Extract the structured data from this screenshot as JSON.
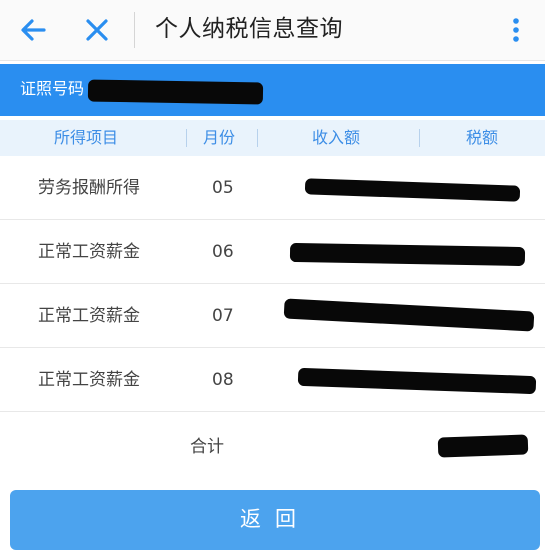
{
  "header": {
    "title": "个人纳税信息查询"
  },
  "id_bar": {
    "label": "证照号码"
  },
  "table": {
    "headers": [
      "所得项目",
      "月份",
      "收入额",
      "税额"
    ],
    "rows": [
      {
        "item": "劳务报酬所得",
        "month": "05"
      },
      {
        "item": "正常工资薪金",
        "month": "06"
      },
      {
        "item": "正常工资薪金",
        "month": "07"
      },
      {
        "item": "正常工资薪金",
        "month": "08"
      }
    ],
    "total_label": "合计"
  },
  "footer": {
    "back_button": "返回"
  },
  "colors": {
    "primary": "#2a8ef0",
    "header_text": "#3d8ee6",
    "button": "#4ca3ee"
  },
  "icons": {
    "back": "arrow-left-icon",
    "close": "close-icon",
    "menu": "more-vertical-icon"
  }
}
